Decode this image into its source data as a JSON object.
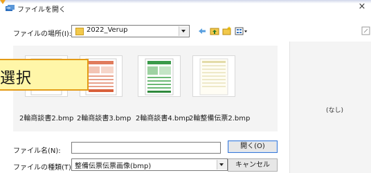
{
  "window": {
    "title": "ファイルを開く",
    "close_glyph": "×"
  },
  "location": {
    "label": "ファイルの場所(I):",
    "value": "2022_Verup"
  },
  "files": [
    {
      "name": "2輪商談書2.bmp"
    },
    {
      "name": "2輪商談書3.bmp"
    },
    {
      "name": "2輪商談書4.bmp"
    },
    {
      "name": "2輪整備伝票2.bmp"
    }
  ],
  "preview": {
    "empty_text": "(なし)"
  },
  "filename": {
    "label": "ファイル名(N):",
    "value": ""
  },
  "filetype": {
    "label": "ファイルの種類(T):",
    "value": "整備伝票伝票画像(bmp)"
  },
  "buttons": {
    "open": "開く(O)",
    "cancel": "キャンセル"
  },
  "callout": {
    "text": "選択"
  },
  "colors": {
    "callout_fill": "#fff6a8",
    "callout_border": "#e39b16",
    "pane_bg": "#f4f4f4"
  },
  "icons": {
    "title": "open-dialog-icon",
    "folder": "folder-icon",
    "back": "back-arrow-icon",
    "up": "up-folder-icon",
    "new_folder": "new-folder-icon",
    "views": "view-menu-icon"
  }
}
